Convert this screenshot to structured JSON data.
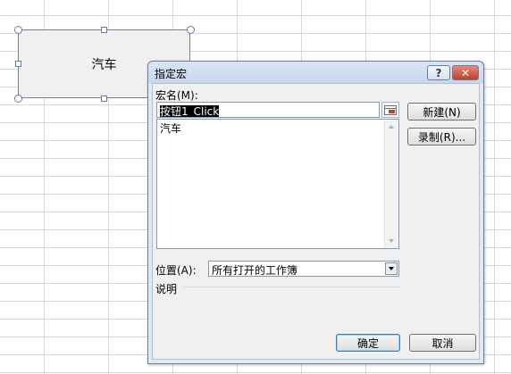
{
  "shape": {
    "text": "汽车"
  },
  "dialog": {
    "title": "指定宏",
    "help_label": "?",
    "close_label": "✕",
    "macro_name_label": "宏名(M):",
    "macro_name_value": "按钮1_Click",
    "macro_list": [
      "汽车"
    ],
    "new_button": "新建(N)",
    "record_button": "录制(R)...",
    "location_label": "位置(A):",
    "location_value": "所有打开的工作簿",
    "description_label": "说明",
    "ok_button": "确定",
    "cancel_button": "取消"
  },
  "icons": {
    "ref_edit": "range-select-icon"
  }
}
